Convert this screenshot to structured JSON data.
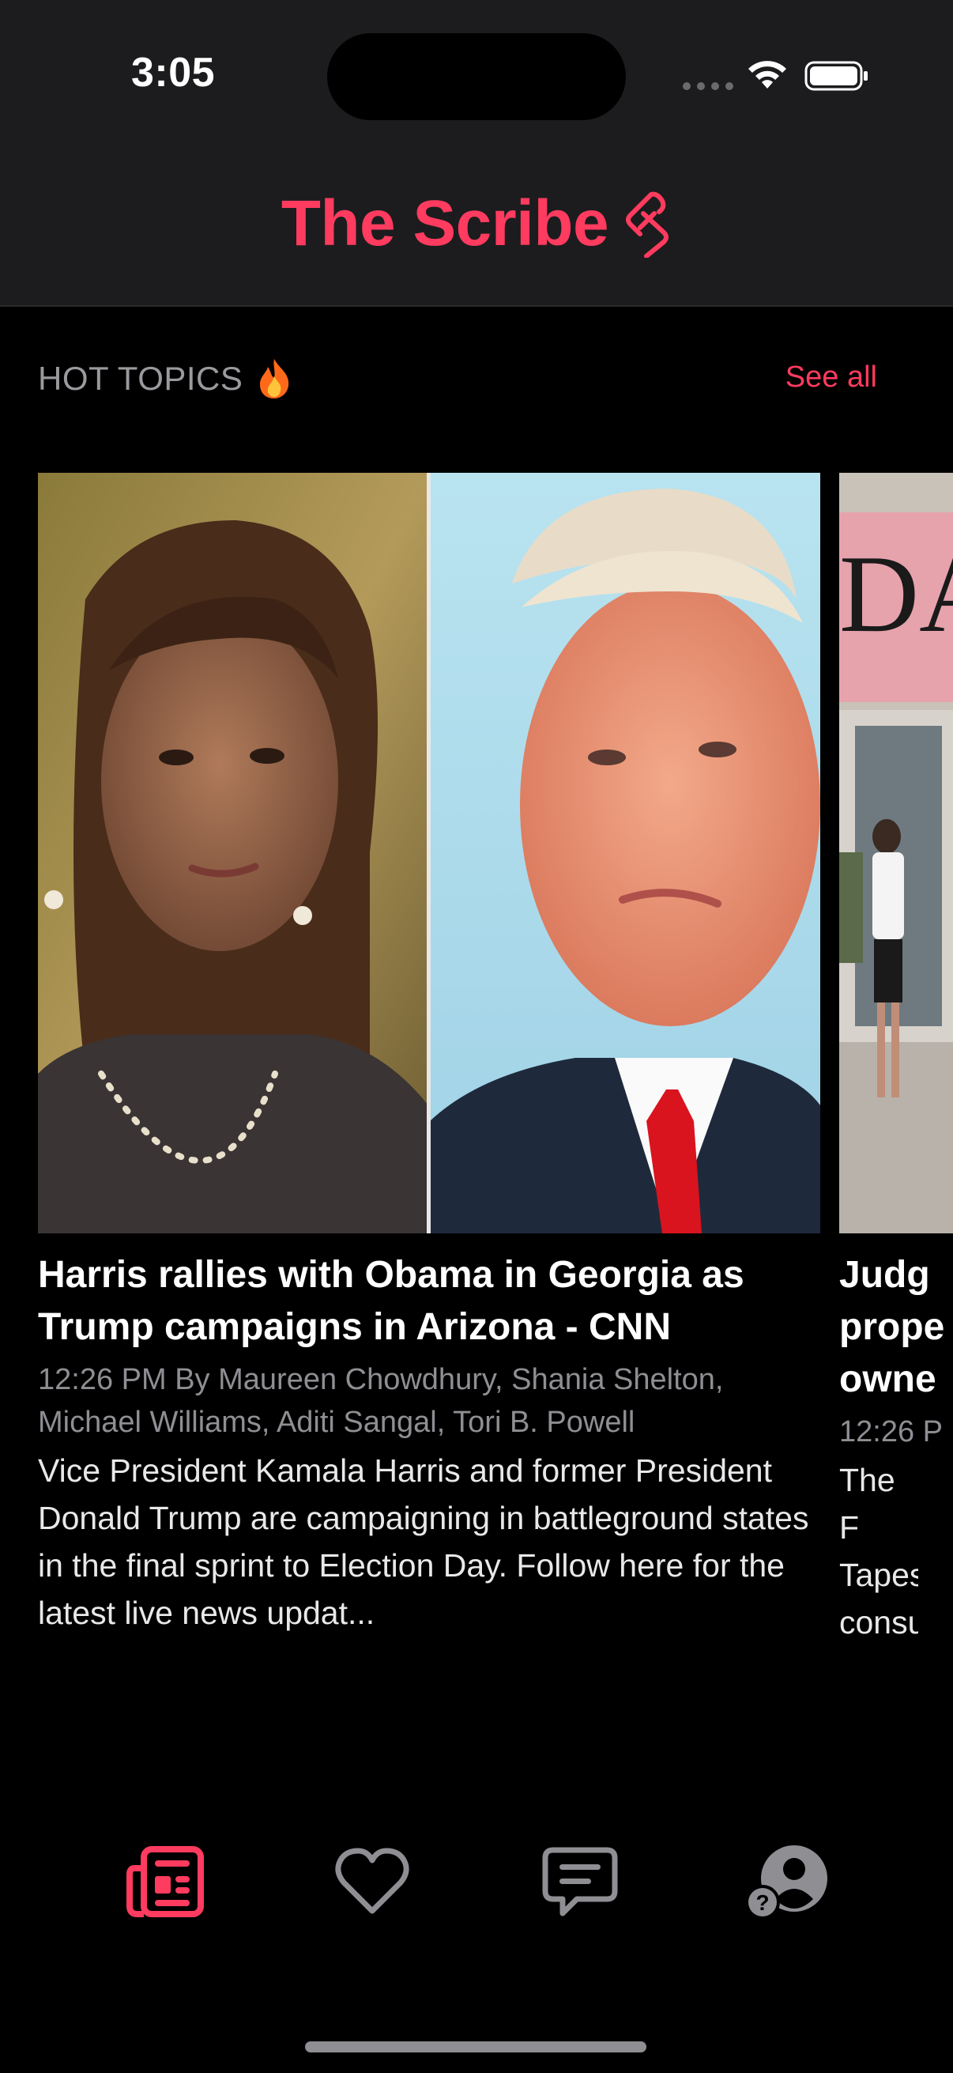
{
  "status_bar": {
    "time": "3:05"
  },
  "header": {
    "title": "The Scribe",
    "logo_icon": "scribe-link-logo"
  },
  "section": {
    "title": "HOT TOPICS",
    "icon": "fire-icon",
    "see_all_label": "See all"
  },
  "cards": [
    {
      "headline": "Harris rallies with Obama in Georgia as Trump campaigns in Arizona - CNN",
      "meta": "12:26 PM By Maureen Chowdhury, Shania Shelton, Michael Williams, Aditi Sangal, Tori B. Powell",
      "description": "Vice President Kamala Harris and former President Donald Trump are campaigning in battleground states in the final sprint to Election Day. Follow here for the latest live news updat..."
    },
    {
      "headline": "Judg prope owne",
      "meta": "12:26 P",
      "description": "The F Tapes consu"
    }
  ],
  "tab_bar": {
    "tabs": [
      {
        "name": "news-icon",
        "active": true
      },
      {
        "name": "heart-icon",
        "active": false
      },
      {
        "name": "chat-icon",
        "active": false
      },
      {
        "name": "profile-help-icon",
        "active": false
      }
    ]
  },
  "colors": {
    "accent": "#ff3b5f",
    "background": "#000000",
    "header_bg": "#1c1c1e"
  }
}
